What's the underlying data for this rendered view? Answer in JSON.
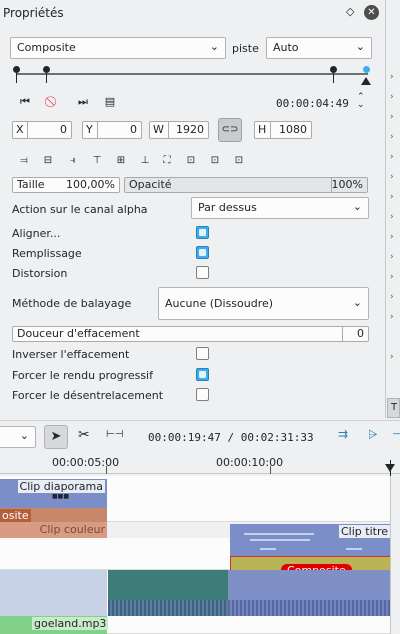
{
  "panel": {
    "title": "Propriétés"
  },
  "transition": {
    "type_value": "Composite",
    "track_label": "piste",
    "track_value": "Auto"
  },
  "timecode": "00:00:04:49",
  "geometry": {
    "x_label": "X",
    "x": "0",
    "y_label": "Y",
    "y": "0",
    "w_label": "W",
    "w": "1920",
    "h_label": "H",
    "h": "1080"
  },
  "size": {
    "label": "Taille",
    "value": "100,00%"
  },
  "opacity": {
    "label": "Opacité",
    "value": "100%"
  },
  "alpha": {
    "label": "Action sur le canal alpha",
    "value": "Par dessus"
  },
  "options": {
    "align": "Aligner...",
    "fill": "Remplissage",
    "distort": "Distorsion",
    "wipe_method_label": "Méthode de balayage",
    "wipe_method_value": "Aucune (Dissoudre)",
    "softness_label": "Douceur d'effacement",
    "softness_value": "0",
    "invert": "Inverser l'effacement",
    "progressive": "Forcer le rendu progressif",
    "deinterlace": "Forcer le désentrelacement"
  },
  "checks": {
    "align": true,
    "fill": true,
    "distort": false,
    "invert": false,
    "progressive": true,
    "deinterlace": false
  },
  "toolbar": {
    "position": "00:00:19:47 / 00:02:31:33"
  },
  "ruler": {
    "t1": "00:00:05:00",
    "t2": "00:00:10:00"
  },
  "clips": {
    "diaporama": "Clip diaporama",
    "composite_left": "osite",
    "couleur": "Clip couleur",
    "titre": "Clip titre",
    "composite": "Composite",
    "audio": "goeland.mp3"
  },
  "side_tab": "T"
}
